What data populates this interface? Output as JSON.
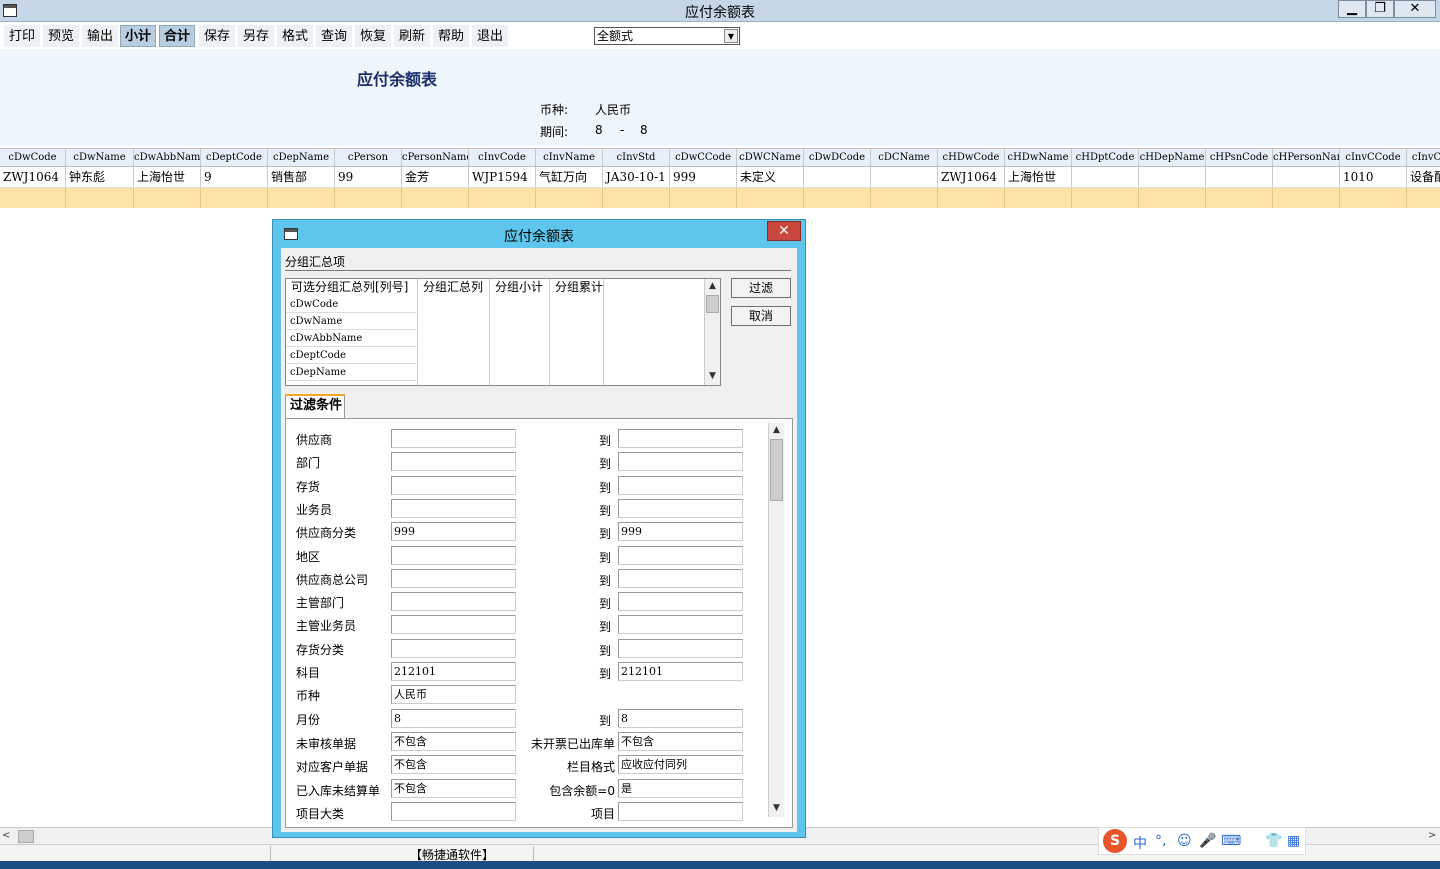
{
  "window": {
    "title": "应付余额表",
    "minimize": "▁",
    "restore": "❐",
    "close": "✕"
  },
  "toolbar": {
    "buttons": [
      "打印",
      "预览",
      "输出",
      "小计",
      "合计",
      "保存",
      "另存",
      "格式",
      "查询",
      "恢复",
      "刷新",
      "帮助",
      "退出"
    ],
    "format_select": "全额式"
  },
  "report": {
    "title": "应付余额表",
    "currency_label": "币种:",
    "currency_value": "人民币",
    "period_label": "期间:",
    "period_from": "8",
    "period_dash": "-",
    "period_to": "8"
  },
  "grid": {
    "columns": [
      "cDwCode",
      "cDwName",
      "cDwAbbName",
      "cDeptCode",
      "cDepName",
      "cPerson",
      "cPersonName",
      "cInvCode",
      "cInvName",
      "cInvStd",
      "cDwCCode",
      "cDWCName",
      "cDwDCode",
      "cDCName",
      "cHDwCode",
      "cHDwName",
      "cHDptCode",
      "cHDepName",
      "cHPsnCode",
      "cHPersonName",
      "cInvCCode",
      "cInvC"
    ],
    "rows": [
      [
        "ZWJ1064",
        "钟东彪",
        "上海怡世",
        "9",
        "销售部",
        "99",
        "金芳",
        "WJP1594",
        "气缸万向",
        "JA30-10-1",
        "999",
        "未定义",
        "",
        "",
        "ZWJ1064",
        "上海怡世",
        "",
        "",
        "",
        "",
        "1010",
        "设备配"
      ]
    ]
  },
  "dialog": {
    "title": "应付余额表",
    "close": "✕",
    "group_title": "分组汇总项",
    "listbox_headers": [
      "可选分组汇总列[列号]",
      "分组汇总列",
      "分组小计",
      "分组累计"
    ],
    "listbox_items": [
      "cDwCode",
      "cDwName",
      "cDwAbbName",
      "cDeptCode",
      "cDepName"
    ],
    "filter_button": "过滤",
    "cancel_button": "取消",
    "tab_label": "过滤条件",
    "to_label": "到",
    "fields": [
      {
        "label": "供应商",
        "from": "",
        "to": "",
        "has_to": true
      },
      {
        "label": "部门",
        "from": "",
        "to": "",
        "has_to": true
      },
      {
        "label": "存货",
        "from": "",
        "to": "",
        "has_to": true
      },
      {
        "label": "业务员",
        "from": "",
        "to": "",
        "has_to": true
      },
      {
        "label": "供应商分类",
        "from": "999",
        "to": "999",
        "has_to": true
      },
      {
        "label": "地区",
        "from": "",
        "to": "",
        "has_to": true
      },
      {
        "label": "供应商总公司",
        "from": "",
        "to": "",
        "has_to": true
      },
      {
        "label": "主管部门",
        "from": "",
        "to": "",
        "has_to": true
      },
      {
        "label": "主管业务员",
        "from": "",
        "to": "",
        "has_to": true
      },
      {
        "label": "存货分类",
        "from": "",
        "to": "",
        "has_to": true
      },
      {
        "label": "科目",
        "from": "212101",
        "to": "212101",
        "has_to": true
      },
      {
        "label": "币种",
        "from": "人民币",
        "to": "",
        "has_to": false
      },
      {
        "label": "月份",
        "from": "8",
        "to": "8",
        "has_to": true
      }
    ],
    "options": [
      {
        "label": "未审核单据",
        "value": "不包含",
        "label2": "未开票已出库单",
        "value2": "不包含"
      },
      {
        "label": "对应客户单据",
        "value": "不包含",
        "label2": "栏目格式",
        "value2": "应收应付同列"
      },
      {
        "label": "已入库未结算单",
        "value": "不包含",
        "label2": "包含余额=0",
        "value2": "是"
      },
      {
        "label": "项目大类",
        "value": "",
        "label2": "项目",
        "value2": ""
      }
    ]
  },
  "statusbar": {
    "text": "【畅捷通软件】"
  },
  "ime": {
    "items": [
      "中",
      "°,",
      "☺",
      "🎤",
      "⌨",
      "👕",
      "▦"
    ]
  }
}
